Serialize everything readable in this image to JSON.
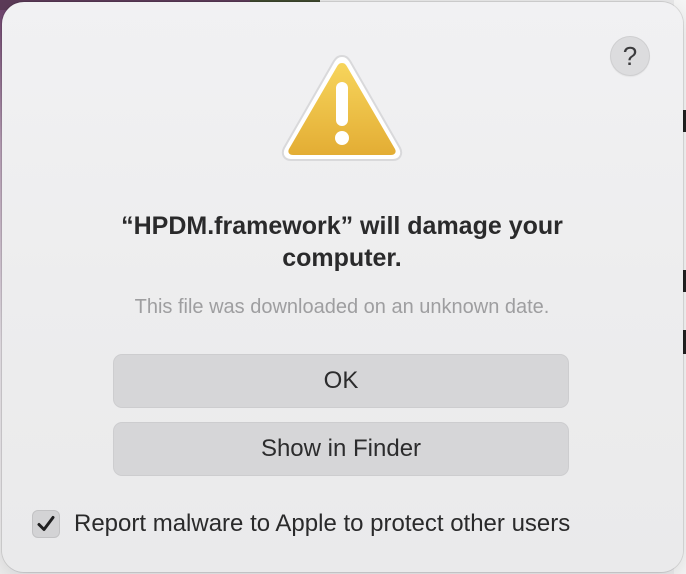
{
  "dialog": {
    "help_label": "?",
    "title": "“HPDM.framework” will damage your computer.",
    "subtitle": "This file was downloaded on an unknown date.",
    "ok_label": "OK",
    "show_in_finder_label": "Show in Finder",
    "report_checkbox": {
      "label": "Report malware to Apple to protect other users",
      "checked": true
    },
    "icon": "warning-icon"
  },
  "colors": {
    "warning_yellow": "#f2c84b",
    "warning_yellow_dark": "#e0a92b",
    "button_bg": "#d6d6d8",
    "dialog_bg": "#ededee"
  }
}
